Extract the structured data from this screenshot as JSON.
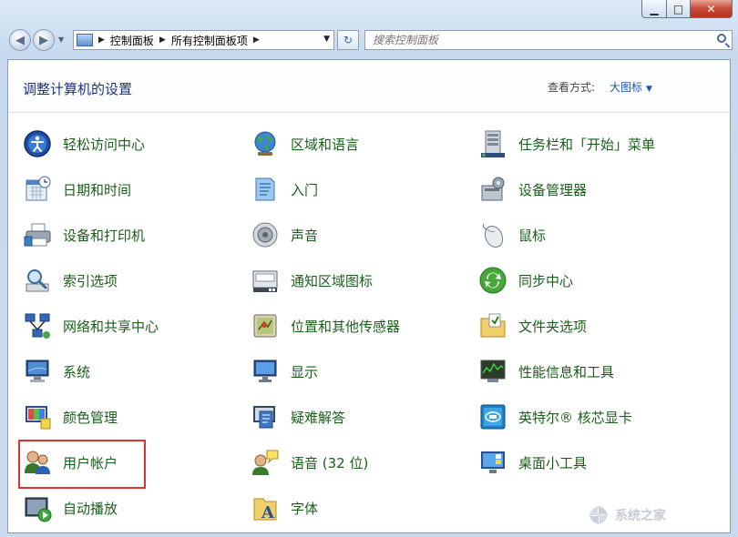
{
  "window": {
    "controls": {
      "minimize": "▁",
      "maximize": "□",
      "close": "✕"
    }
  },
  "nav": {
    "back_icon": "arrow-left-icon",
    "forward_icon": "arrow-right-icon",
    "breadcrumb": [
      "控制面板",
      "所有控制面板项"
    ],
    "search_placeholder": "搜索控制面板"
  },
  "header": {
    "title": "调整计算机的设置",
    "view_by_label": "查看方式:",
    "view_by_value": "大图标"
  },
  "items": [
    {
      "label": "轻松访问中心",
      "icon": "ease-of-access-icon"
    },
    {
      "label": "区域和语言",
      "icon": "globe-icon"
    },
    {
      "label": "任务栏和「开始」菜单",
      "icon": "taskbar-icon"
    },
    {
      "label": "日期和时间",
      "icon": "calendar-clock-icon"
    },
    {
      "label": "入门",
      "icon": "getting-started-icon"
    },
    {
      "label": "设备管理器",
      "icon": "device-manager-icon"
    },
    {
      "label": "设备和打印机",
      "icon": "printer-icon"
    },
    {
      "label": "声音",
      "icon": "speaker-icon"
    },
    {
      "label": "鼠标",
      "icon": "mouse-icon"
    },
    {
      "label": "索引选项",
      "icon": "indexing-icon"
    },
    {
      "label": "通知区域图标",
      "icon": "notification-area-icon"
    },
    {
      "label": "同步中心",
      "icon": "sync-icon"
    },
    {
      "label": "网络和共享中心",
      "icon": "network-icon"
    },
    {
      "label": "位置和其他传感器",
      "icon": "sensor-icon"
    },
    {
      "label": "文件夹选项",
      "icon": "folder-options-icon"
    },
    {
      "label": "系统",
      "icon": "system-icon"
    },
    {
      "label": "显示",
      "icon": "display-icon"
    },
    {
      "label": "性能信息和工具",
      "icon": "performance-icon"
    },
    {
      "label": "颜色管理",
      "icon": "color-management-icon"
    },
    {
      "label": "疑难解答",
      "icon": "troubleshooting-icon"
    },
    {
      "label": "英特尔® 核芯显卡",
      "icon": "intel-graphics-icon"
    },
    {
      "label": "用户帐户",
      "icon": "user-accounts-icon"
    },
    {
      "label": "语音 (32 位)",
      "icon": "speech-icon"
    },
    {
      "label": "桌面小工具",
      "icon": "gadgets-icon"
    },
    {
      "label": "自动播放",
      "icon": "autoplay-icon"
    },
    {
      "label": "字体",
      "icon": "fonts-icon"
    }
  ],
  "watermark": {
    "text": "系统之家"
  },
  "colors": {
    "link_green": "#1a5e1a",
    "title_blue": "#1e3287",
    "highlight_red": "#d83434"
  }
}
